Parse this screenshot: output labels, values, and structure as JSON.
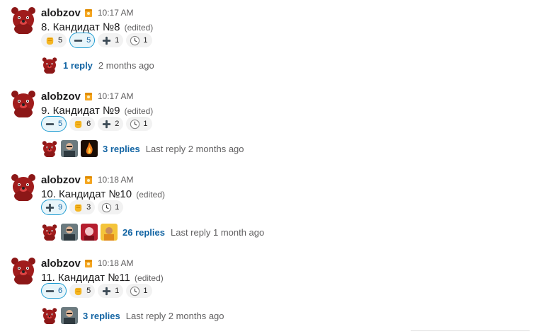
{
  "messages": [
    {
      "author": "alobzov",
      "time": "10:17 AM",
      "text": "8. Кандидат №8",
      "edited": "(edited)",
      "reactions": [
        {
          "emoji": "fist-icon",
          "count": "5",
          "mine": false
        },
        {
          "emoji": "minus-icon",
          "count": "5",
          "mine": true
        },
        {
          "emoji": "plus-icon",
          "count": "1",
          "mine": false
        },
        {
          "emoji": "clock-icon",
          "count": "1",
          "mine": false
        }
      ],
      "thread": {
        "avatars": [
          "avatar-bear"
        ],
        "replies": "1 reply",
        "last": "2 months ago"
      }
    },
    {
      "author": "alobzov",
      "time": "10:17 AM",
      "text": "9. Кандидат №9",
      "edited": "(edited)",
      "reactions": [
        {
          "emoji": "minus-icon",
          "count": "5",
          "mine": true
        },
        {
          "emoji": "fist-icon",
          "count": "6",
          "mine": false
        },
        {
          "emoji": "plus-icon",
          "count": "2",
          "mine": false
        },
        {
          "emoji": "clock-icon",
          "count": "1",
          "mine": false
        }
      ],
      "thread": {
        "avatars": [
          "avatar-bear",
          "avatar-man",
          "avatar-fire"
        ],
        "replies": "3 replies",
        "last": "Last reply 2 months ago"
      }
    },
    {
      "author": "alobzov",
      "time": "10:18 AM",
      "text": "10. Кандидат №10",
      "edited": "(edited)",
      "reactions": [
        {
          "emoji": "plus-icon",
          "count": "9",
          "mine": true
        },
        {
          "emoji": "fist-icon",
          "count": "3",
          "mine": false
        },
        {
          "emoji": "clock-icon",
          "count": "1",
          "mine": false
        }
      ],
      "thread": {
        "avatars": [
          "avatar-bear",
          "avatar-man",
          "avatar-red",
          "avatar-yellow"
        ],
        "replies": "26 replies",
        "last": "Last reply 1 month ago"
      }
    },
    {
      "author": "alobzov",
      "time": "10:18 AM",
      "text": "11. Кандидат №11",
      "edited": "(edited)",
      "reactions": [
        {
          "emoji": "minus-icon",
          "count": "6",
          "mine": true
        },
        {
          "emoji": "fist-icon",
          "count": "5",
          "mine": false
        },
        {
          "emoji": "plus-icon",
          "count": "1",
          "mine": false
        },
        {
          "emoji": "clock-icon",
          "count": "1",
          "mine": false
        }
      ],
      "thread": {
        "avatars": [
          "avatar-bear",
          "avatar-man"
        ],
        "replies": "3 replies",
        "last": "Last reply 2 months ago"
      }
    }
  ],
  "colors": {
    "link": "#1264a3",
    "accent_border": "#1d9bd1",
    "avatar_red": "#9b1b1b"
  }
}
